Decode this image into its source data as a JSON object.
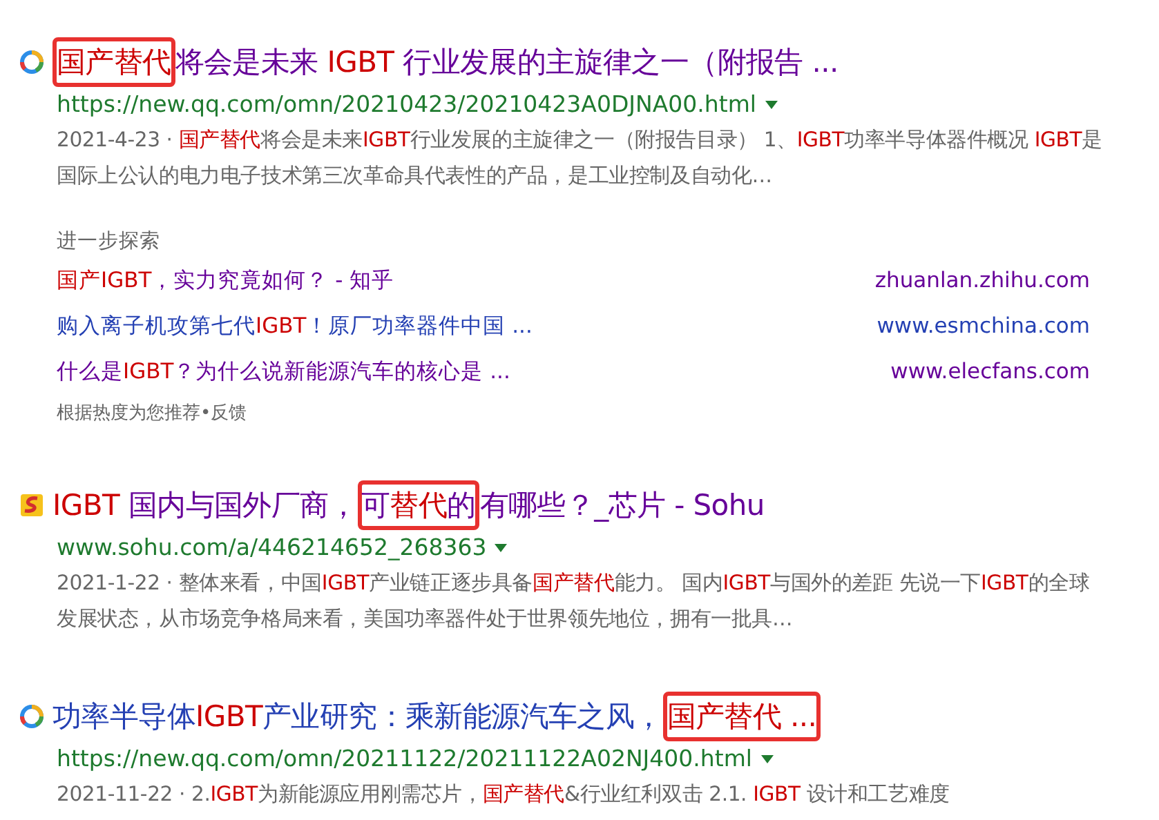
{
  "results": [
    {
      "kind": "ring",
      "visited": true,
      "title": [
        {
          "text": "国产替代",
          "highlight": true,
          "boxed": true
        },
        {
          "text": "将会是未来 ",
          "highlight": false,
          "boxed": false
        },
        {
          "text": "IGBT",
          "highlight": true,
          "boxed": false
        },
        {
          "text": " 行业发展的主旋律之一（附报告 ...",
          "highlight": false,
          "boxed": false
        }
      ],
      "url": "https://new.qq.com/omn/20210423/20210423A0DJNA00.html",
      "date": "2021-4-23 ·",
      "snippet": [
        {
          "text": "国产替代",
          "highlight": true
        },
        {
          "text": "将会是未来",
          "highlight": false
        },
        {
          "text": "IGBT",
          "highlight": true
        },
        {
          "text": "行业发展的主旋律之一（附报告目录） 1、",
          "highlight": false
        },
        {
          "text": "IGBT",
          "highlight": true
        },
        {
          "text": "功率半导体器件概况 ",
          "highlight": false
        },
        {
          "text": "IGBT",
          "highlight": true
        },
        {
          "text": "是国际上公认的电力电子技术第三次革命具代表性的产品，是工业控制及自动化…",
          "highlight": false
        }
      ],
      "explore": {
        "heading": "进一步探索",
        "links": [
          {
            "visited": true,
            "title": [
              {
                "text": "国产IGBT",
                "highlight": true
              },
              {
                "text": "，实力究竟如何？ - 知乎",
                "highlight": false
              }
            ],
            "site": "zhuanlan.zhihu.com"
          },
          {
            "visited": false,
            "title": [
              {
                "text": "购入离子机攻第七代",
                "highlight": false
              },
              {
                "text": "IGBT",
                "highlight": true
              },
              {
                "text": "！原厂功率器件中国 ...",
                "highlight": false
              }
            ],
            "site": "www.esmchina.com"
          },
          {
            "visited": true,
            "title": [
              {
                "text": "什么是",
                "highlight": false
              },
              {
                "text": "IGBT",
                "highlight": true
              },
              {
                "text": "？为什么说新能源汽车的核心是 ...",
                "highlight": false
              }
            ],
            "site": "www.elecfans.com"
          }
        ],
        "footer": "根据热度为您推荐•反馈"
      }
    },
    {
      "kind": "square",
      "visited": true,
      "title": [
        {
          "text": "IGBT",
          "highlight": true,
          "boxed": false
        },
        {
          "text": " 国内与国外厂商，",
          "highlight": false,
          "boxed": false
        },
        {
          "text": "可",
          "highlight": false,
          "boxed": true
        },
        {
          "text": "替代",
          "highlight": true,
          "boxed": true
        },
        {
          "text": "的",
          "highlight": false,
          "boxed": true
        },
        {
          "text": "有哪些？_芯片 - Sohu",
          "highlight": false,
          "boxed": false
        }
      ],
      "url": "www.sohu.com/a/446214652_268363",
      "date": "2021-1-22 ·",
      "snippet": [
        {
          "text": "整体来看，中国",
          "highlight": false
        },
        {
          "text": "IGBT",
          "highlight": true
        },
        {
          "text": "产业链正逐步具备",
          "highlight": false
        },
        {
          "text": "国产替代",
          "highlight": true
        },
        {
          "text": "能力。 国内",
          "highlight": false
        },
        {
          "text": "IGBT",
          "highlight": true
        },
        {
          "text": "与国外的差距 先说一下",
          "highlight": false
        },
        {
          "text": "IGBT",
          "highlight": true
        },
        {
          "text": "的全球发展状态，从市场竞争格局来看，美国功率器件处于世界领先地位，拥有一批具…",
          "highlight": false
        }
      ]
    },
    {
      "kind": "ring",
      "visited": false,
      "title": [
        {
          "text": "功率半导体",
          "highlight": false,
          "boxed": false
        },
        {
          "text": "IGBT",
          "highlight": true,
          "boxed": false
        },
        {
          "text": "产业研究：乘新能源汽车之风，",
          "highlight": false,
          "boxed": false
        },
        {
          "text": "国产替代 ...",
          "highlight": true,
          "boxed": true
        }
      ],
      "url": "https://new.qq.com/omn/20211122/20211122A02NJ400.html",
      "date": "2021-11-22 ·",
      "snippet": [
        {
          "text": "2.",
          "highlight": false
        },
        {
          "text": "IGBT",
          "highlight": true
        },
        {
          "text": "为新能源应用刚需芯片，",
          "highlight": false
        },
        {
          "text": "国产替代",
          "highlight": true
        },
        {
          "text": "&行业红利双击 2.1. ",
          "highlight": false
        },
        {
          "text": "IGBT",
          "highlight": true
        },
        {
          "text": " 设计和工艺难度",
          "highlight": false
        }
      ]
    }
  ]
}
